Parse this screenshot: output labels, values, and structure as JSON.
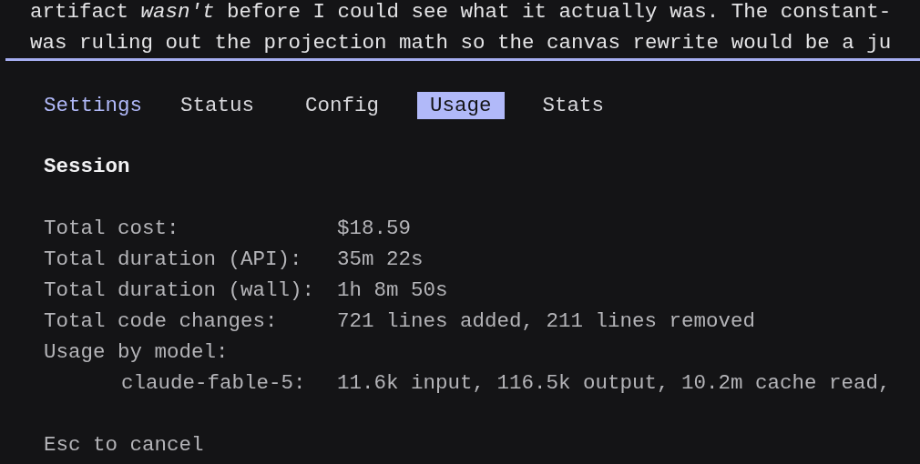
{
  "transcript": [
    "artifact *wasn't* before I could see what it actually was. The constant-",
    "was ruling out the projection math so the canvas rewrite would be a ju"
  ],
  "tabs": {
    "title": "Settings",
    "items": [
      {
        "label": "Status",
        "selected": false
      },
      {
        "label": "Config",
        "selected": false
      },
      {
        "label": "Usage",
        "selected": true
      },
      {
        "label": "Stats",
        "selected": false
      }
    ]
  },
  "section": {
    "title": "Session",
    "rows": [
      {
        "label": "Total cost:",
        "value": "$18.59"
      },
      {
        "label": "Total duration (API):",
        "value": "35m 22s"
      },
      {
        "label": "Total duration (wall):",
        "value": "1h 8m 50s"
      },
      {
        "label": "Total code changes:",
        "value": "721 lines added, 211 lines removed"
      },
      {
        "label": "Usage by model:",
        "value": "",
        "children": [
          {
            "label": "claude-fable-5:",
            "value": "11.6k input, 116.5k output, 10.2m cache read,"
          }
        ]
      }
    ]
  },
  "footer": "Esc to cancel"
}
